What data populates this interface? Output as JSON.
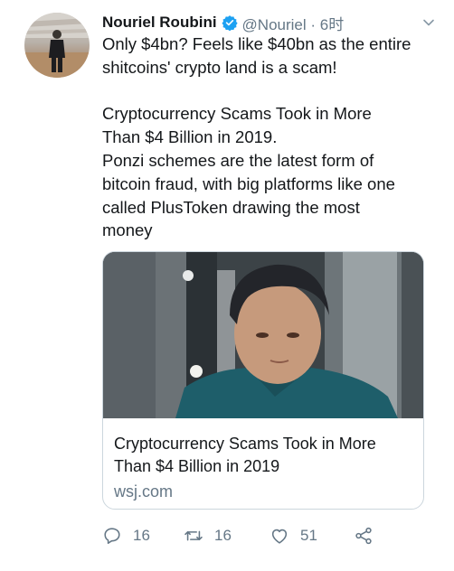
{
  "tweet": {
    "author_name": "Nouriel Roubini",
    "handle_time": "@Nouriel · 6时",
    "text_line1": "Only $4bn? Feels like $40bn as the entire\nshitcoins' crypto land is a scam!",
    "text_line2": "Cryptocurrency Scams Took in More\nThan $4 Billion in 2019.\nPonzi schemes are the latest form of\nbitcoin fraud, with big platforms like one\ncalled PlusToken drawing the most\nmoney"
  },
  "card": {
    "title": "Cryptocurrency Scams Took in More\nThan $4 Billion in 2019",
    "domain": "wsj.com"
  },
  "actions": {
    "reply_count": "16",
    "retweet_count": "16",
    "like_count": "51"
  },
  "icons": {
    "verified": "verified-badge-icon",
    "menu": "chevron-down-icon",
    "reply": "reply-icon",
    "retweet": "retweet-icon",
    "like": "heart-icon",
    "share": "share-icon"
  },
  "colors": {
    "accent": "#1da1f2",
    "secondary_text": "#657786",
    "primary_text": "#14171a",
    "border": "#ccd6dd"
  }
}
